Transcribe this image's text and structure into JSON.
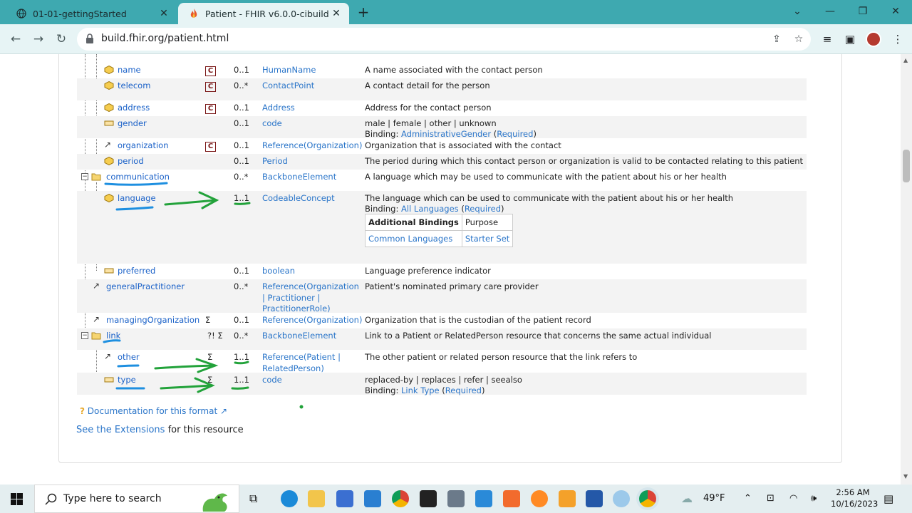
{
  "browser": {
    "tabs": [
      {
        "title": "01-01-gettingStarted",
        "active": false
      },
      {
        "title": "Patient - FHIR v6.0.0-cibuild",
        "active": true
      }
    ],
    "url": "build.fhir.org/patient.html",
    "window_controls": {
      "minimize": "—",
      "restore": "❐",
      "close": "✕"
    }
  },
  "rows": [
    {
      "name": "name",
      "flag": "C",
      "card": "0..1",
      "type": "HumanName",
      "desc": "A name associated with the contact person",
      "kind": "complex"
    },
    {
      "name": "telecom",
      "flag": "C",
      "card": "0..*",
      "type": "ContactPoint",
      "desc": "A contact detail for the person",
      "kind": "complex"
    },
    {
      "name": "address",
      "flag": "C",
      "card": "0..1",
      "type": "Address",
      "desc": "Address for the contact person",
      "kind": "complex"
    },
    {
      "name": "gender",
      "flag": "",
      "card": "0..1",
      "type": "code",
      "desc": "male | female | other | unknown",
      "binding_prefix": "Binding: ",
      "binding": "AdministrativeGender",
      "strength": "Required",
      "kind": "primitive"
    },
    {
      "name": "organization",
      "flag": "C",
      "card": "0..1",
      "type_prefix": "Reference(",
      "type": "Organization",
      "type_suffix": ")",
      "desc": "Organization that is associated with the contact",
      "kind": "reference"
    },
    {
      "name": "period",
      "flag": "",
      "card": "0..1",
      "type": "Period",
      "desc": "The period during which this contact person or organization is valid to be contacted relating to this patient",
      "kind": "complex"
    },
    {
      "name": "communication",
      "flag": "",
      "card": "0..*",
      "type": "BackboneElement",
      "desc": "A language which may be used to communicate with the patient about his or her health",
      "kind": "backbone"
    },
    {
      "name": "language",
      "flag": "",
      "card": "1..1",
      "type": "CodeableConcept",
      "desc": "The language which can be used to communicate with the patient about his or her health",
      "binding_prefix": "Binding: ",
      "binding": "All Languages",
      "strength": "Required",
      "kind": "complex"
    },
    {
      "name": "preferred",
      "flag": "",
      "card": "0..1",
      "type": "boolean",
      "desc": "Language preference indicator",
      "kind": "primitive"
    },
    {
      "name": "generalPractitioner",
      "flag": "",
      "card": "0..*",
      "type_line1": "Reference(Organization",
      "type_line2": "| Practitioner |",
      "type_line3": "PractitionerRole)",
      "desc": "Patient's nominated primary care provider",
      "kind": "reference"
    },
    {
      "name": "managingOrganization",
      "flag": "Σ",
      "card": "0..1",
      "type_prefix": "Reference(",
      "type": "Organization",
      "type_suffix": ")",
      "desc": "Organization that is the custodian of the patient record",
      "kind": "reference"
    },
    {
      "name": "link",
      "flag": "?! Σ",
      "card": "0..*",
      "type": "BackboneElement",
      "desc": "Link to a Patient or RelatedPerson resource that concerns the same actual individual",
      "kind": "backbone"
    },
    {
      "name": "other",
      "flag": "Σ",
      "card": "1..1",
      "type_line1": "Reference(Patient |",
      "type_line2": "RelatedPerson)",
      "desc": "The other patient or related person resource that the link refers to",
      "kind": "reference"
    },
    {
      "name": "type",
      "flag": "Σ",
      "card": "1..1",
      "type": "code",
      "desc": "replaced-by | replaces | refer | seealso",
      "binding_prefix": "Binding: ",
      "binding": "Link Type",
      "strength": "Required",
      "kind": "primitive"
    }
  ],
  "additional_bindings": {
    "header": "Additional Bindings",
    "purpose_header": "Purpose",
    "valueset": "Common Languages",
    "purpose": "Starter Set"
  },
  "footer": {
    "doc_link": "Documentation for this format",
    "ext_link": "See the Extensions",
    "ext_suffix": " for this resource"
  },
  "taskbar": {
    "search_placeholder": "Type here to search",
    "weather": "49°F",
    "time": "2:56 AM",
    "date": "10/16/2023"
  },
  "colors": {
    "tabstrip": "#3ea9b0",
    "toolbar": "#e7f4f5",
    "link": "#2a75c9",
    "annotation_blue": "#1e8fe0",
    "annotation_green": "#22a23a"
  }
}
